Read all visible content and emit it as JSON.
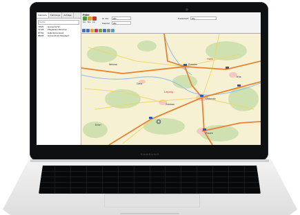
{
  "device": {
    "brand": "SAMSUNG"
  },
  "app": {
    "tabs": [
      {
        "label": "Standorte"
      },
      {
        "label": "Fahrzeuge"
      },
      {
        "label": "Aufträge"
      }
    ],
    "search": {
      "placeholder": "Suche"
    },
    "locations": [
      {
        "code": "74523",
        "name": "Hessental Str."
      },
      {
        "code": "71726",
        "name": "Pflugfelden München"
      },
      {
        "code": "97762",
        "name": "Hallerfetzenstand"
      },
      {
        "code": "88636",
        "name": "Grüneschnitt Strasbach"
      }
    ],
    "filter": {
      "title": "Filter",
      "icons": [
        "new-icon",
        "edit-icon",
        "delete-icon"
      ],
      "icon_labels": [
        "Neu",
        "Bea",
        "Lös"
      ],
      "field1_label": "Gr. Ext.",
      "field1_value": "alle",
      "field2_label": "Standort",
      "field2_value": "alle",
      "field3_label": "Postleitzahl",
      "field3_value": "alle"
    },
    "map": {
      "labels": [
        "Halle",
        "Leipzig",
        "Dresden",
        "Chemnitz",
        "Zwickau",
        "Plauen",
        "Gera",
        "Jena",
        "Erfurt",
        "Weimar"
      ]
    }
  }
}
